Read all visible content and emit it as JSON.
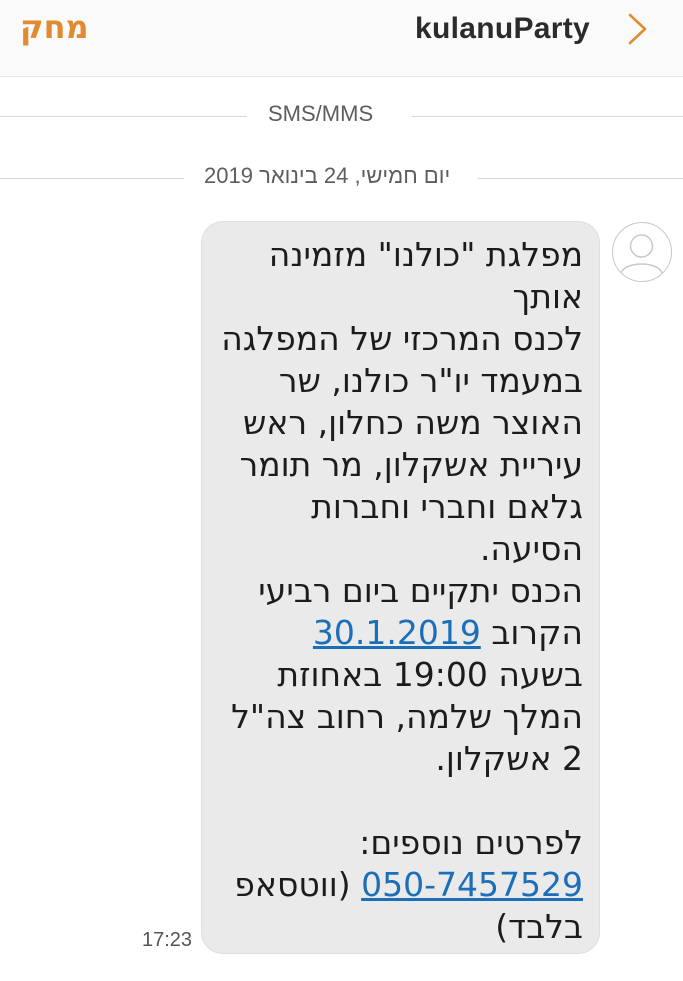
{
  "header": {
    "delete_label": "מחק",
    "title": "kulanuParty",
    "back_icon": "chevron-right-icon",
    "accent_color": "#e28a2f"
  },
  "channel_divider": {
    "label": "SMS/MMS"
  },
  "date_divider": {
    "label": "יום חמישי, 24 בינואר 2019"
  },
  "message": {
    "avatar_icon": "person-icon",
    "line_intro": "מפלגת \"כולנו\" מזמינה אותך\nלכנס המרכזי של המפלגה במעמד יו\"ר כולנו, שר האוצר משה כחלון, ראש עיריית אשקלון, מר תומר גלאם וחברי וחברות הסיעה.\nהכנס יתקיים ביום רביעי הקרוב ",
    "date_link": "30.1.2019",
    "line_middle": "\nבשעה 19:00 באחוזת המלך שלמה, רחוב צה\"ל 2 אשקלון.\n\nלפרטים נוספים:\n",
    "phone_link": "050-7457529",
    "line_end": " (ווטסאפ בלבד)",
    "time": "17:23",
    "bubble_color": "#eaeaea",
    "link_color": "#1a6fb8"
  }
}
